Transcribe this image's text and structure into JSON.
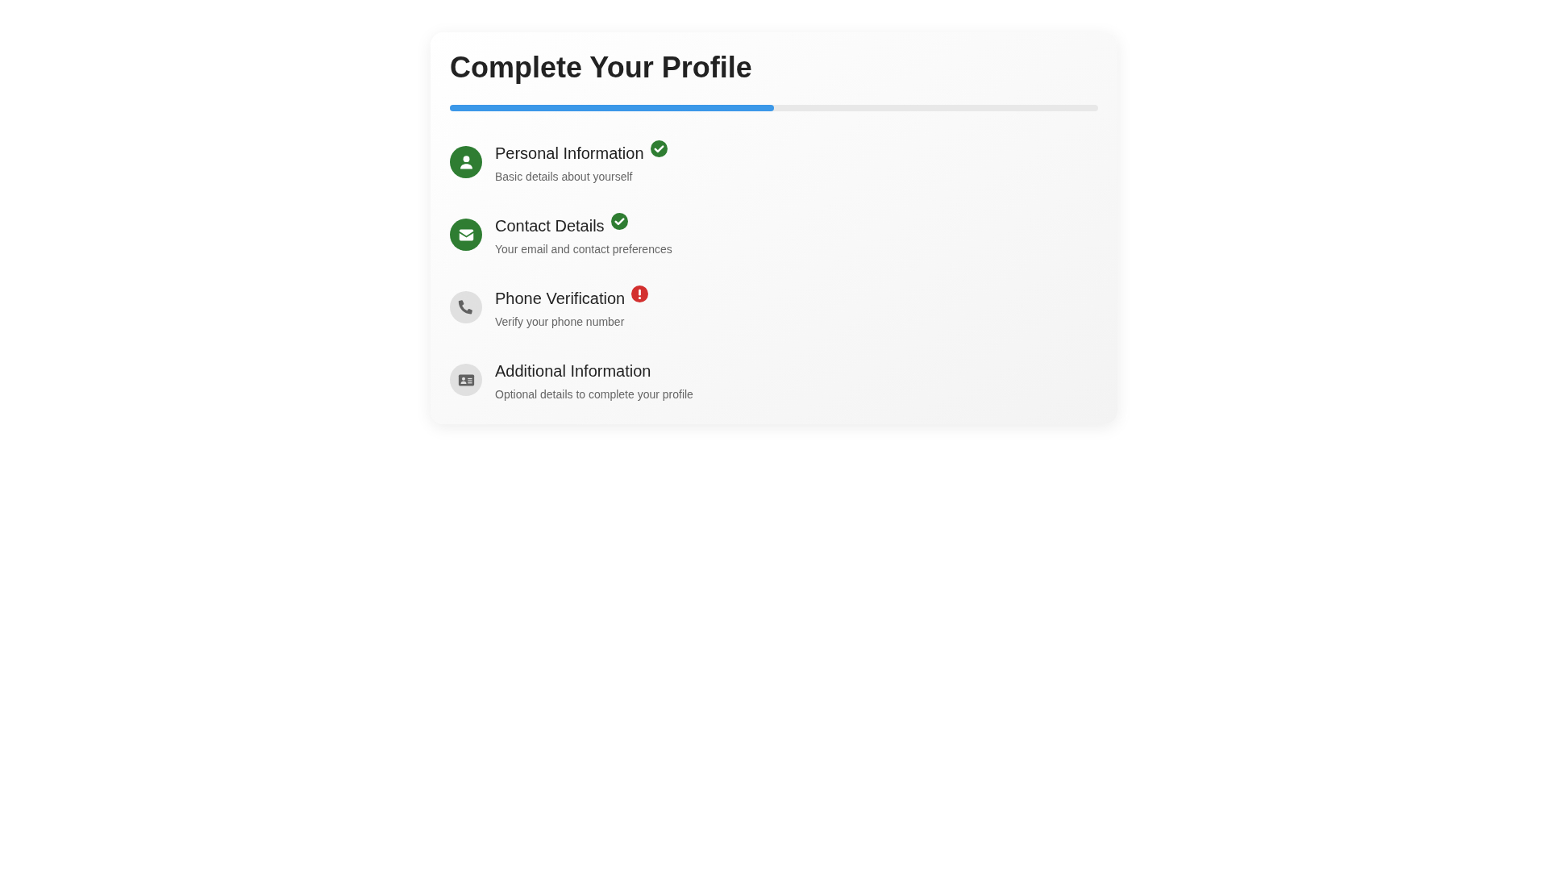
{
  "title": "Complete Your Profile",
  "progress": {
    "level": 0.5
  },
  "steps": [
    {
      "kind": "person",
      "title": "Personal Information",
      "description": "Basic details about yourself",
      "completed": true,
      "error": false
    },
    {
      "kind": "mail",
      "title": "Contact Details",
      "description": "Your email and contact preferences",
      "completed": true,
      "error": false
    },
    {
      "kind": "phone",
      "title": "Phone Verification",
      "description": "Verify your phone number",
      "completed": false,
      "error": true
    },
    {
      "kind": "card",
      "title": "Additional Information",
      "description": "Optional details to complete your profile",
      "completed": false,
      "error": false
    }
  ]
}
